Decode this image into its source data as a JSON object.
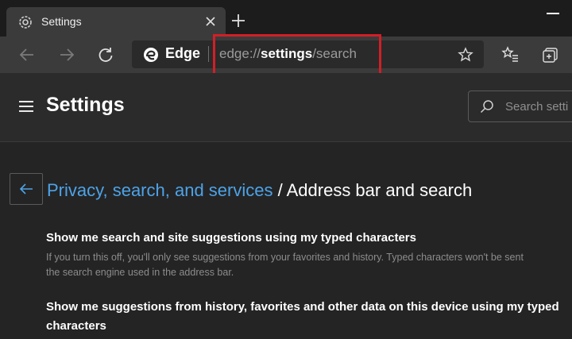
{
  "tab": {
    "title": "Settings"
  },
  "toolbar": {
    "site_label": "Edge",
    "url_prefix": "edge://",
    "url_bold": "settings",
    "url_suffix": "/search"
  },
  "header": {
    "title": "Settings",
    "search_placeholder": "Search setti"
  },
  "breadcrumb": {
    "link": "Privacy, search, and services",
    "separator": " / ",
    "current": "Address bar and search"
  },
  "settings": [
    {
      "title": "Show me search and site suggestions using my typed characters",
      "description_line1": "If you turn this off, you'll only see suggestions from your favorites and history. Typed characters won't be sent",
      "description_line2": "the search engine used in the address bar."
    },
    {
      "title_line1": "Show me suggestions from history, favorites and other data on this device using my typed",
      "title_line2": "characters"
    }
  ],
  "colors": {
    "accent_link": "#4da3e8",
    "highlight_border": "#d21f26",
    "background": "#242424"
  },
  "icons": [
    "settings-gear-icon",
    "close-icon",
    "plus-icon",
    "back-arrow-icon",
    "forward-arrow-icon",
    "refresh-icon",
    "edge-logo-icon",
    "star-icon",
    "favorites-icon",
    "collections-icon",
    "hamburger-icon",
    "search-icon"
  ]
}
